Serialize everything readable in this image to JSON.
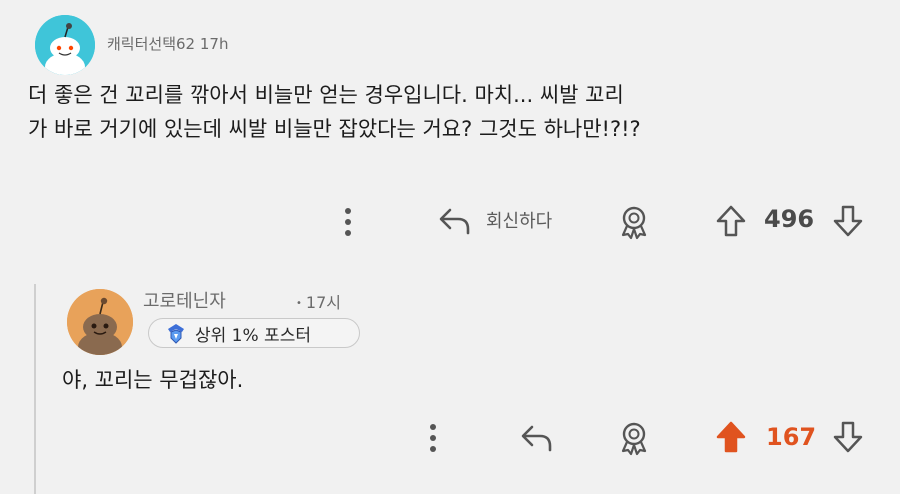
{
  "comment": {
    "username": "캐릭터선택62",
    "time": "17h",
    "body": "더 좋은 건 꼬리를 깎아서 비늘만 얻는 경우입니다. 마치... 씨발 꼬리\n가 바로 거기에 있는데 씨발 비늘만 잡았다는 거요? 그것도 하나만!?!?",
    "reply_label": "회신하다",
    "score": "496",
    "avatar_color": "#3fc5d9"
  },
  "reply": {
    "username": "고로테닌자",
    "time": "17시",
    "flair": "상위 1% 포스터",
    "body": "야, 꼬리는 무겁잖아.",
    "score": "167",
    "avatar_color": "#e8a25a",
    "upvote_color": "#e0531f"
  },
  "icons": {
    "more": "more-vertical-icon",
    "reply": "reply-arrow-icon",
    "award": "award-icon",
    "upvote": "upvote-arrow-icon",
    "downvote": "downvote-arrow-icon"
  }
}
